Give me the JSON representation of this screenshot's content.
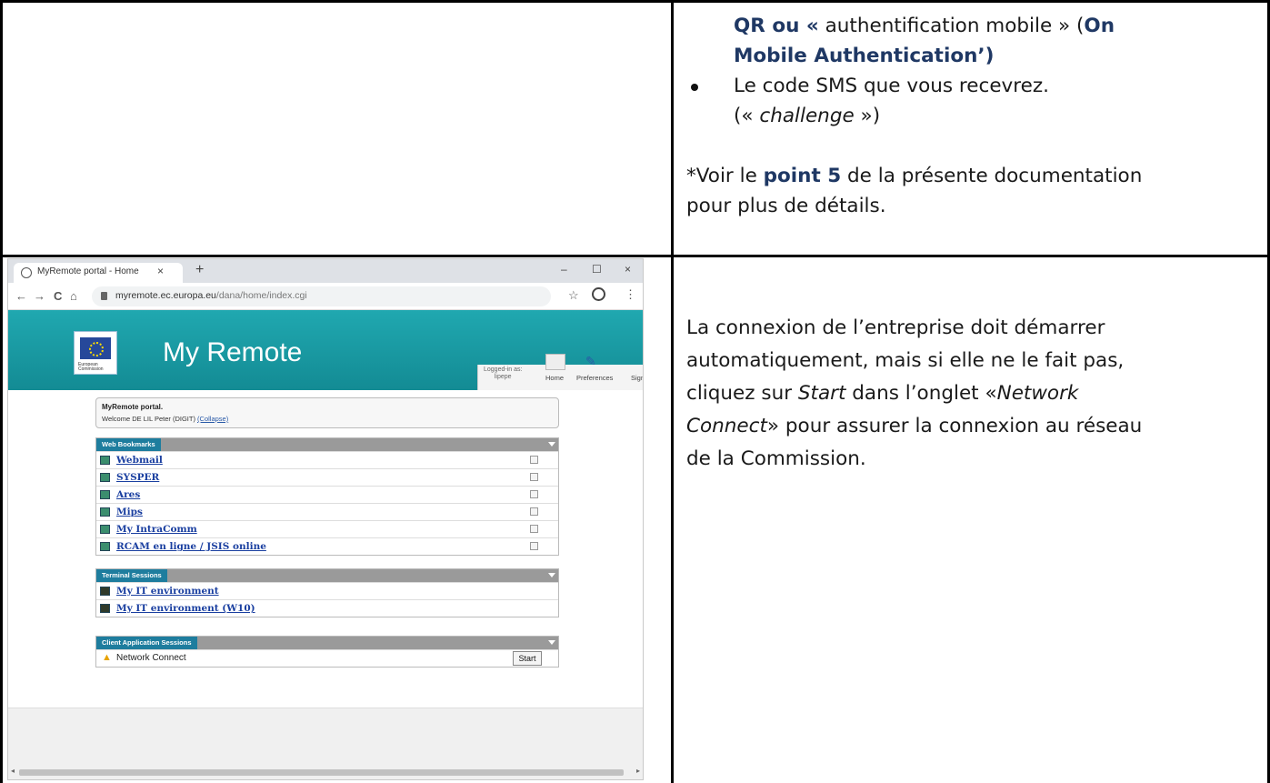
{
  "top_right": {
    "line1_bold_a": "QR ou «",
    "line1_regular": " authentification mobile » (",
    "line1_bold_b": "On",
    "line2_bold": "Mobile Authentication’)",
    "bullet_line1": "Le code SMS que vous recevrez.",
    "bullet_line2_prefix": "(« ",
    "bullet_line2_italic": "challenge",
    "bullet_line2_suffix": " »)",
    "note_prefix": "*Voir le ",
    "note_bold": "point 5",
    "note_mid": " de la présente documentation",
    "note_line2": "pour plus de détails."
  },
  "bottom_right": {
    "line1": "La connexion de l’entreprise doit démarrer",
    "line2": "automatiquement, mais si elle ne le fait pas,",
    "line3_prefix": "cliquez sur ",
    "line3_italic_a": "Start",
    "line3_mid": " dans l’onglet «",
    "line3_italic_b": "Network",
    "line4_italic": "Connect",
    "line4_suffix": "» pour assurer la connexion au réseau",
    "line5": "de la Commission."
  },
  "browser": {
    "tab_title": "MyRemote portal - Home",
    "tab_close": "×",
    "new_tab": "+",
    "minimize": "–",
    "maximize": "☐",
    "close": "×",
    "back": "←",
    "forward": "→",
    "reload": "C",
    "home": "⌂",
    "url_host": "myremote.ec.europa.eu",
    "url_path": "/dana/home/index.cgi",
    "star": "☆",
    "menu": "⋮",
    "eu_logo_text": "European Commission",
    "site_title": "My Remote",
    "logged_in_label": "Logged-in as:",
    "logged_in_user": "lipepe",
    "home_label": "Home",
    "preferences_label": "Preferences",
    "sign_label": "Sign",
    "portal_title": "MyRemote portal.",
    "portal_welcome": "Welcome DE LIL Peter (DIGIT) ",
    "portal_collapse": "(Collapse)",
    "web_bookmarks_header": "Web Bookmarks",
    "web_bookmarks": [
      "Webmail",
      "SYSPER",
      "Ares",
      "Mips",
      "My IntraComm",
      "RCAM en ligne / JSIS online"
    ],
    "terminal_header": "Terminal Sessions",
    "terminal_sessions": [
      "My IT environment",
      "My IT environment (W10)"
    ],
    "client_header": "Client Application Sessions",
    "client_app": "Network Connect",
    "start_button": "Start"
  }
}
